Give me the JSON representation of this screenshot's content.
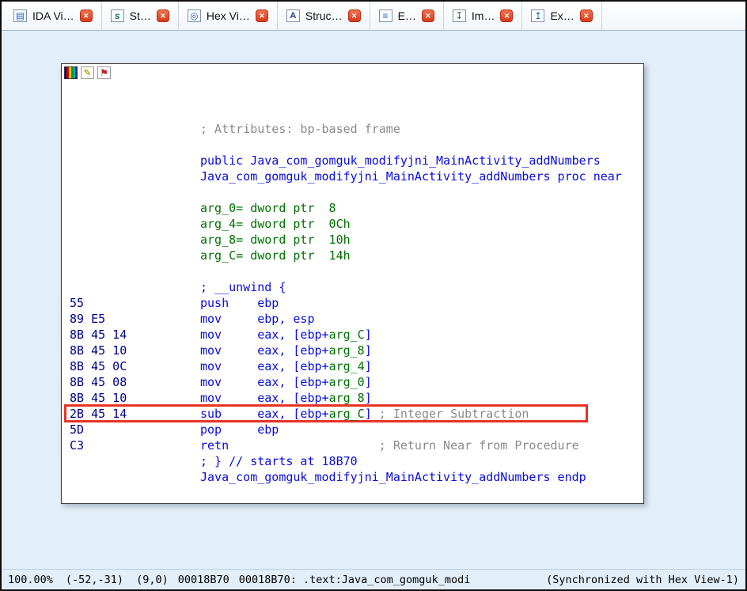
{
  "colors": {
    "code": "#0b0be0",
    "comment": "#8a8a8a",
    "stackvar": "#007000",
    "bytes": "#00008b",
    "highlight": "#e83323"
  },
  "tabs": [
    {
      "id": "ida-view",
      "label": "IDA Vi…",
      "icon": "ida-view-icon"
    },
    {
      "id": "strings",
      "label": "St…",
      "icon": "strings-icon"
    },
    {
      "id": "hex-view",
      "label": "Hex Vi…",
      "icon": "hex-view-icon"
    },
    {
      "id": "structures",
      "label": "Struc…",
      "icon": "structures-icon"
    },
    {
      "id": "enums",
      "label": "E…",
      "icon": "enums-icon"
    },
    {
      "id": "imports",
      "label": "Im…",
      "icon": "imports-icon"
    },
    {
      "id": "exports",
      "label": "Ex…",
      "icon": "exports-icon"
    }
  ],
  "panel": {
    "toolbar_icons": [
      "navigation-band-icon",
      "edit-icon",
      "flag-icon"
    ]
  },
  "disasm": {
    "lines": [
      {
        "blank": true
      },
      {
        "blank": true
      },
      {
        "segments": [
          {
            "t": "; Attributes: bp-based frame",
            "c": "comment"
          }
        ]
      },
      {
        "blank": true
      },
      {
        "segments": [
          {
            "t": "public Java_com_gomguk_modifyjni_MainActivity_addNumbers",
            "c": "code"
          }
        ]
      },
      {
        "segments": [
          {
            "t": "Java_com_gomguk_modifyjni_MainActivity_addNumbers proc near",
            "c": "code"
          }
        ]
      },
      {
        "blank": true
      },
      {
        "segments": [
          {
            "t": "arg_0= dword ptr  8",
            "c": "stackvar"
          }
        ]
      },
      {
        "segments": [
          {
            "t": "arg_4= dword ptr  0Ch",
            "c": "stackvar"
          }
        ]
      },
      {
        "segments": [
          {
            "t": "arg_8= dword ptr  10h",
            "c": "stackvar"
          }
        ]
      },
      {
        "segments": [
          {
            "t": "arg_C= dword ptr  14h",
            "c": "stackvar"
          }
        ]
      },
      {
        "blank": true
      },
      {
        "segments": [
          {
            "t": "; __unwind {",
            "c": "code"
          }
        ]
      },
      {
        "bytes": "55",
        "segments": [
          {
            "t": "push    ebp",
            "c": "code"
          }
        ]
      },
      {
        "bytes": "89 E5",
        "segments": [
          {
            "t": "mov     ebp, esp",
            "c": "code"
          }
        ]
      },
      {
        "bytes": "8B 45 14",
        "segments": [
          {
            "t": "mov     eax, [ebp+",
            "c": "code"
          },
          {
            "t": "arg_C",
            "c": "stackvar"
          },
          {
            "t": "]",
            "c": "code"
          }
        ]
      },
      {
        "bytes": "8B 45 10",
        "segments": [
          {
            "t": "mov     eax, [ebp+",
            "c": "code"
          },
          {
            "t": "arg_8",
            "c": "stackvar"
          },
          {
            "t": "]",
            "c": "code"
          }
        ]
      },
      {
        "bytes": "8B 45 0C",
        "segments": [
          {
            "t": "mov     eax, [ebp+",
            "c": "code"
          },
          {
            "t": "arg_4",
            "c": "stackvar"
          },
          {
            "t": "]",
            "c": "code"
          }
        ]
      },
      {
        "bytes": "8B 45 08",
        "segments": [
          {
            "t": "mov     eax, [ebp+",
            "c": "code"
          },
          {
            "t": "arg_0",
            "c": "stackvar"
          },
          {
            "t": "]",
            "c": "code"
          }
        ]
      },
      {
        "bytes": "8B 45 10",
        "segments": [
          {
            "t": "mov     eax, [ebp+",
            "c": "code"
          },
          {
            "t": "arg_8",
            "c": "stackvar"
          },
          {
            "t": "]",
            "c": "code"
          }
        ]
      },
      {
        "bytes": "2B 45 14",
        "highlight": true,
        "segments": [
          {
            "t": "sub     eax, [ebp+",
            "c": "code"
          },
          {
            "t": "arg_C",
            "c": "stackvar"
          },
          {
            "t": "] ",
            "c": "code"
          },
          {
            "t": "; Integer Subtraction",
            "c": "comment"
          }
        ]
      },
      {
        "bytes": "5D",
        "segments": [
          {
            "t": "pop     ebp",
            "c": "code"
          }
        ]
      },
      {
        "bytes": "C3",
        "segments": [
          {
            "t": "retn",
            "c": "code"
          },
          {
            "t": "                     ",
            "c": "plain"
          },
          {
            "t": "; Return Near from Procedure",
            "c": "comment"
          }
        ]
      },
      {
        "segments": [
          {
            "t": "; } // starts at 18B70",
            "c": "code"
          }
        ]
      },
      {
        "segments": [
          {
            "t": "Java_com_gomguk_modifyjni_MainActivity_addNumbers endp",
            "c": "code"
          }
        ]
      }
    ]
  },
  "statusbar": {
    "zoom": "100.00%",
    "coords": "(-52,-31)",
    "cell": "(9,0)",
    "address": "00018B70",
    "location": "00018B70: .text:Java_com_gomguk_modi",
    "sync": "(Synchronized with Hex View-1)"
  }
}
